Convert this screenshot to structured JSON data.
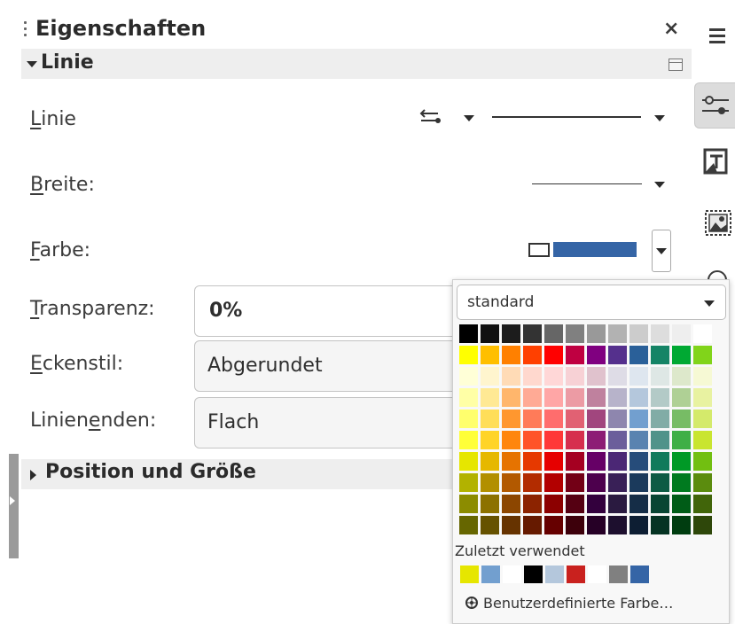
{
  "panel": {
    "title": "Eigenschaften",
    "close": "×"
  },
  "section_linie": {
    "title": "Linie"
  },
  "rows": {
    "line": {
      "label_u": "L",
      "label_rest": "inie"
    },
    "width": {
      "label_u": "B",
      "label_rest": "reite:"
    },
    "color": {
      "label_u": "F",
      "label_rest": "arbe:"
    },
    "transparency": {
      "label_u": "T",
      "label_rest": "ransparenz:",
      "value": "0%"
    },
    "corner": {
      "label_u": "E",
      "label_rest": "ckenstil:",
      "value": "Abgerundet"
    },
    "endcaps": {
      "label_pre": "Linien",
      "label_u": "e",
      "label_rest": "nden:",
      "value": "Flach"
    }
  },
  "section_position": {
    "title": "Position und Größe"
  },
  "current_color": "#3565a6",
  "color_popup": {
    "palette_name": "standard",
    "palette": [
      [
        "#000000",
        "#111111",
        "#1c1c1c",
        "#333333",
        "#666666",
        "#808080",
        "#999999",
        "#b2b2b2",
        "#cccccc",
        "#dddddd",
        "#eeeeee",
        "#ffffff"
      ],
      [
        "#ffff00",
        "#ffbf00",
        "#ff8000",
        "#ff4000",
        "#ff0000",
        "#bf0041",
        "#800080",
        "#55308d",
        "#2a6099",
        "#158466",
        "#00a933",
        "#81d41a"
      ],
      [
        "#ffffd7",
        "#fff5ce",
        "#ffdbb6",
        "#ffd8ce",
        "#ffd7d7",
        "#f7d1d5",
        "#e0c2cd",
        "#dedce6",
        "#dee6ef",
        "#dee7e5",
        "#dde8cb",
        "#f6f9d4"
      ],
      [
        "#ffffa6",
        "#ffe994",
        "#ffb66c",
        "#ffaa95",
        "#ffa6a6",
        "#ec9ba4",
        "#bf819e",
        "#b7b3ca",
        "#b4c7dc",
        "#b3cac7",
        "#afd095",
        "#e8f2a1"
      ],
      [
        "#ffff6d",
        "#ffde59",
        "#ff972f",
        "#ff7b59",
        "#ff6d6d",
        "#e16173",
        "#a1467e",
        "#8e86ae",
        "#729fcf",
        "#81aca6",
        "#77bc65",
        "#d4ea6b"
      ],
      [
        "#ffff38",
        "#ffd428",
        "#ff860d",
        "#ff5429",
        "#ff3838",
        "#d62e4e",
        "#8d1d75",
        "#6b5e9b",
        "#5983b0",
        "#50938a",
        "#3faf46",
        "#c9e530"
      ],
      [
        "#e6e600",
        "#e6b800",
        "#e67300",
        "#e63900",
        "#e60000",
        "#a50021",
        "#660066",
        "#4b2775",
        "#264c7a",
        "#107a5b",
        "#009926",
        "#72bf11"
      ],
      [
        "#b2b200",
        "#b28f00",
        "#b25900",
        "#b22c00",
        "#b20000",
        "#730016",
        "#4d004d",
        "#392057",
        "#1b3a5c",
        "#0d5b44",
        "#007a1f",
        "#5b8c0e"
      ],
      [
        "#8c8c00",
        "#8c7100",
        "#8c4600",
        "#8c2300",
        "#8c0000",
        "#550012",
        "#33003d",
        "#2a1a40",
        "#152d47",
        "#084533",
        "#005c17",
        "#41650a"
      ],
      [
        "#666600",
        "#665200",
        "#663300",
        "#661a00",
        "#660000",
        "#3d000b",
        "#260026",
        "#1d0f2e",
        "#0d1e33",
        "#053323",
        "#003d10",
        "#2e470a"
      ]
    ],
    "recent_label": "Zuletzt verwendet",
    "recent": [
      "#e6e600",
      "#729fcf",
      "#ffffff",
      "#000000",
      "#b4c7dc",
      "#c9211e",
      "#ffffff",
      "#808080",
      "#3565a6"
    ],
    "custom_label": "Benutzerdefinierte Farbe…"
  },
  "icons": {
    "grip": "grip-dots-icon",
    "menu": "hamburger-menu-icon",
    "properties": "properties-sliders-icon",
    "styles": "styles-icon",
    "gallery": "gallery-image-icon",
    "navigator": "navigator-icon",
    "custom": "palette-icon"
  }
}
